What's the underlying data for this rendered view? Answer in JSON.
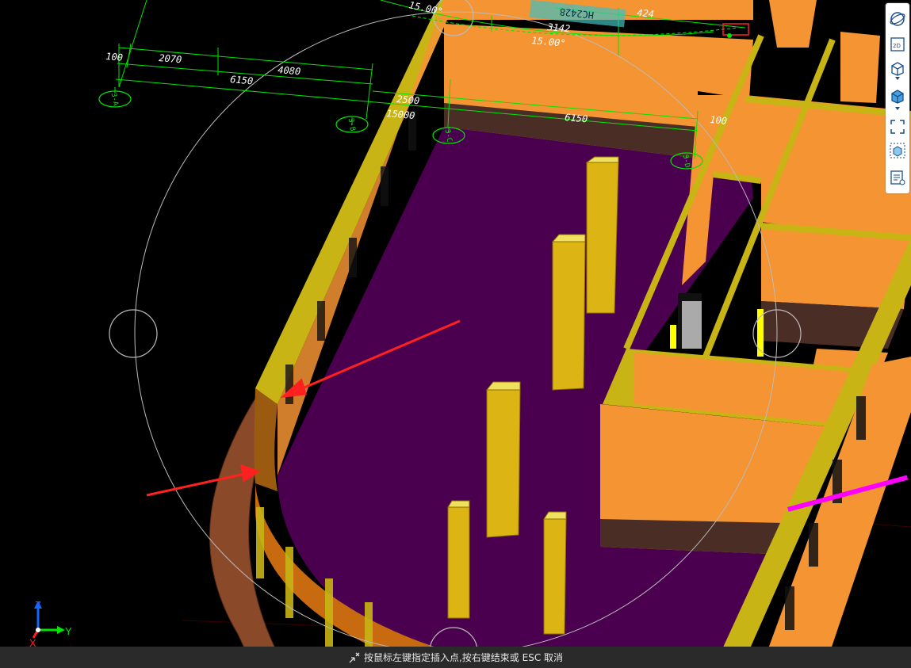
{
  "viewport": {
    "dimensions": [
      {
        "text": "100"
      },
      {
        "text": "2070"
      },
      {
        "text": "4080"
      },
      {
        "text": "6150"
      },
      {
        "text": "2500"
      },
      {
        "text": "15000"
      },
      {
        "text": "6150"
      },
      {
        "text": "100"
      },
      {
        "text": "3142"
      },
      {
        "text": "15.00°"
      },
      {
        "text": "15.00°"
      },
      {
        "text": "424"
      },
      {
        "text": "HC2428"
      }
    ],
    "axis_markers": [
      {
        "text": "3-A"
      },
      {
        "text": "3-B"
      },
      {
        "text": "3-C"
      },
      {
        "text": "3-D"
      }
    ],
    "gizmo": {
      "x_label": "X",
      "y_label": "Y",
      "z_label": "Z"
    }
  },
  "toolbar": {
    "items": [
      {
        "name": "orbit-icon"
      },
      {
        "name": "2d-icon",
        "label": "2D"
      },
      {
        "name": "3d-box-icon"
      },
      {
        "name": "solid-box-icon"
      },
      {
        "name": "zoom-extents-icon"
      },
      {
        "name": "cube-view-icon"
      },
      {
        "name": "layer-list-icon"
      }
    ]
  },
  "status_bar": {
    "message": "按鼠标左键指定插入点,按右键结束或 ESC 取消"
  },
  "colors": {
    "wall": "#f59433",
    "wall_top": "#c8b414",
    "floor": "#4d0050",
    "column": "#dcb414",
    "dimension": "#00e600",
    "background": "#000000"
  }
}
